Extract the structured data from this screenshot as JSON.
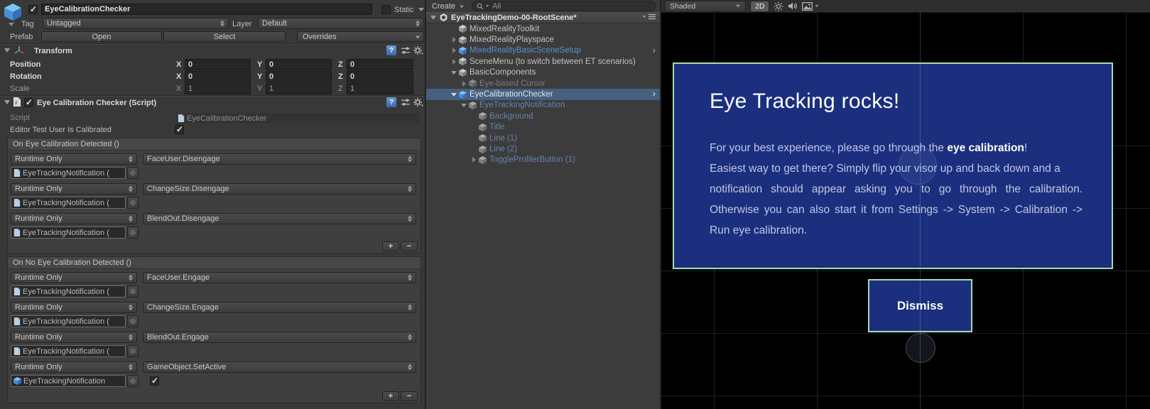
{
  "inspector": {
    "header": {
      "name": "EyeCalibrationChecker",
      "static_label": "Static",
      "tag_label": "Tag",
      "tag_value": "Untagged",
      "layer_label": "Layer",
      "layer_value": "Default",
      "prefab_label": "Prefab",
      "prefab_open": "Open",
      "prefab_select": "Select",
      "prefab_overrides": "Overrides"
    },
    "transform": {
      "title": "Transform",
      "axis_labels": {
        "x": "X",
        "y": "Y",
        "z": "Z"
      },
      "rows": [
        {
          "label": "Position",
          "x": "0",
          "y": "0",
          "z": "0"
        },
        {
          "label": "Rotation",
          "x": "0",
          "y": "0",
          "z": "0"
        },
        {
          "label": "Scale",
          "x": "1",
          "y": "1",
          "z": "1"
        }
      ]
    },
    "script": {
      "title": "Eye Calibration Checker (Script)",
      "script_label": "Script",
      "script_value": "EyeCalibrationChecker",
      "bool_label": "Editor Test User Is Calibrated",
      "add_label": "+",
      "remove_label": "−",
      "events": [
        {
          "title": "On Eye Calibration Detected ()",
          "entries": [
            {
              "mode": "Runtime Only",
              "function": "FaceUser.Disengage",
              "target": "EyeTrackingNotification ("
            },
            {
              "mode": "Runtime Only",
              "function": "ChangeSize.Disengage",
              "target": "EyeTrackingNotification ("
            },
            {
              "mode": "Runtime Only",
              "function": "BlendOut.Disengage",
              "target": "EyeTrackingNotification ("
            }
          ]
        },
        {
          "title": "On No Eye Calibration Detected ()",
          "entries": [
            {
              "mode": "Runtime Only",
              "function": "FaceUser.Engage",
              "target": "EyeTrackingNotification ("
            },
            {
              "mode": "Runtime Only",
              "function": "ChangeSize.Engage",
              "target": "EyeTrackingNotification ("
            },
            {
              "mode": "Runtime Only",
              "function": "BlendOut.Engage",
              "target": "EyeTrackingNotification ("
            },
            {
              "mode": "Runtime Only",
              "function": "GameObject.SetActive",
              "target": "EyeTrackingNotification"
            }
          ]
        }
      ]
    }
  },
  "hierarchy": {
    "create_label": "Create",
    "search_value": "All",
    "scene_name": "EyeTrackingDemo-00-RootScene*",
    "items": [
      {
        "label": "MixedRealityToolkit"
      },
      {
        "label": "MixedRealityPlayspace"
      },
      {
        "label": "MixedRealityBasicSceneSetup"
      },
      {
        "label": "SceneMenu (to switch between ET scenarios)"
      },
      {
        "label": "BasicComponents"
      },
      {
        "label": "Eye-based Cursor"
      },
      {
        "label": "EyeCalibrationChecker"
      },
      {
        "label": "EyeTrackingNotification"
      },
      {
        "label": "Background"
      },
      {
        "label": "Title"
      },
      {
        "label": "Line (1)"
      },
      {
        "label": "Line (2)"
      },
      {
        "label": "ToggleProfilerButton (1)"
      }
    ]
  },
  "scene_view": {
    "toolbar": {
      "shading": "Shaded",
      "mode_2d": "2D"
    },
    "notification": {
      "title": "Eye Tracking rocks!",
      "line1_pre": "For your best experience, please go through the ",
      "line1_em": "eye calibration",
      "line1_post": "!",
      "line2": "Easiest way to get there? Simply flip your visor up and back down and a",
      "line3": "notification should appear asking you to go through the calibration.",
      "line4": "Otherwise you can also start it from Settings -> System -> Calibration ->",
      "line5": "Run eye calibration.",
      "dismiss_label": "Dismiss"
    }
  },
  "colors": {
    "notification_bg": "#1b2f7e",
    "selection_outline": "#a9dcab",
    "prefab_text_blue": "#5a8fd0",
    "inactive_prefab_text": "#6583ac",
    "hierarchy_selection_bg": "#46607f",
    "panel_bg": "#383838",
    "scene_bg": "#000000"
  }
}
